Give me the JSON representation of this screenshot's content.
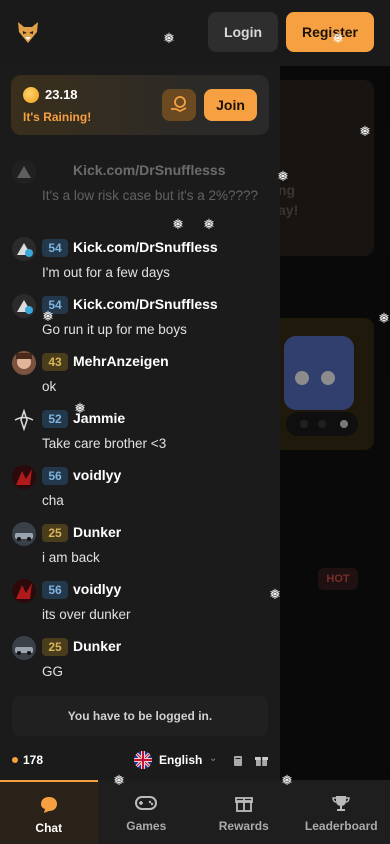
{
  "header": {
    "login_label": "Login",
    "register_label": "Register"
  },
  "rain": {
    "amount": "23.18",
    "status": "It's Raining!",
    "join_label": "Join"
  },
  "background": {
    "card_text": "ng\nay!",
    "hot_badge": "HOT"
  },
  "chat": {
    "messages": [
      {
        "level": "",
        "level_color": "blue",
        "username": "Kick.com/DrSnufflesss",
        "text": "It's a low risk case but it's a 2%????",
        "faded": true,
        "avatar": "snow-avatar"
      },
      {
        "level": "54",
        "level_color": "blue",
        "username": "Kick.com/DrSnuffless",
        "text": "I'm out for a few days",
        "faded": false,
        "avatar": "snow-avatar"
      },
      {
        "level": "54",
        "level_color": "blue",
        "username": "Kick.com/DrSnuffless",
        "text": "Go run it up for me boys",
        "faded": false,
        "avatar": "snow-avatar"
      },
      {
        "level": "43",
        "level_color": "gold",
        "username": "MehrAnzeigen",
        "text": "ok",
        "faded": false,
        "avatar": "face-avatar"
      },
      {
        "level": "52",
        "level_color": "blue",
        "username": "Jammie",
        "text": "Take care brother <3",
        "faded": false,
        "avatar": "emblem-avatar"
      },
      {
        "level": "56",
        "level_color": "blue",
        "username": "voidlyy",
        "text": "cha",
        "faded": false,
        "avatar": "red-avatar"
      },
      {
        "level": "25",
        "level_color": "gold",
        "username": "Dunker",
        "text": "i am back",
        "faded": false,
        "avatar": "car-avatar"
      },
      {
        "level": "56",
        "level_color": "blue",
        "username": "voidlyy",
        "text": "its over dunker",
        "faded": false,
        "avatar": "red-avatar"
      },
      {
        "level": "25",
        "level_color": "gold",
        "username": "Dunker",
        "text": "GG",
        "faded": false,
        "avatar": "car-avatar"
      }
    ],
    "login_note": "You have to be logged in.",
    "online_count": "178",
    "language": "English"
  },
  "nav": {
    "items": [
      {
        "label": "Chat",
        "icon": "chat-bubble-icon",
        "active": true
      },
      {
        "label": "Games",
        "icon": "gamepad-icon",
        "active": false
      },
      {
        "label": "Rewards",
        "icon": "gift-icon",
        "active": false
      },
      {
        "label": "Leaderboard",
        "icon": "trophy-icon",
        "active": false
      }
    ]
  },
  "colors": {
    "accent": "#f7a042",
    "drawer_bg": "#1b1b1b",
    "level_blue": "#23384a",
    "level_gold": "#4a3d1b"
  }
}
